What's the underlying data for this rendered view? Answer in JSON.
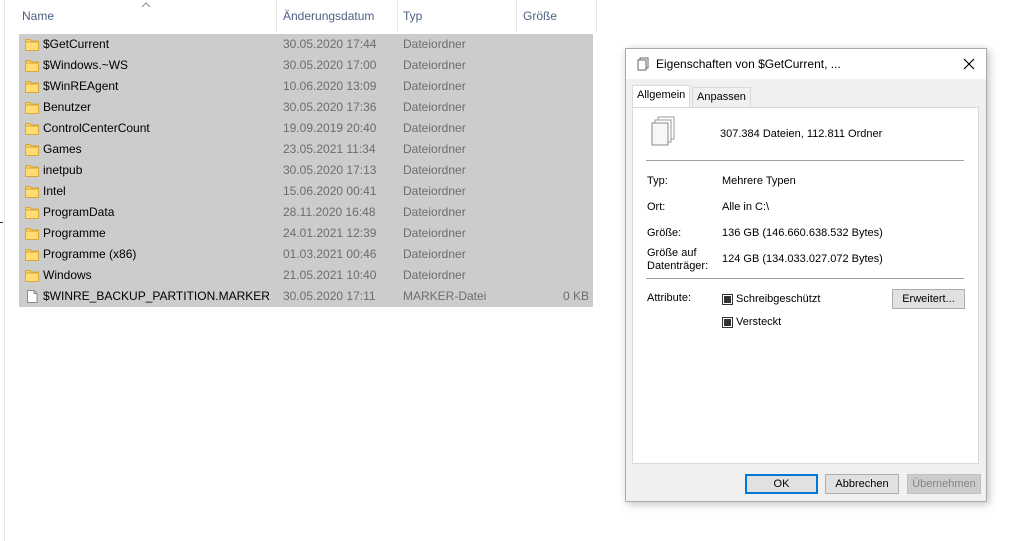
{
  "explorer": {
    "columns": {
      "name": "Name",
      "date": "Änderungsdatum",
      "type": "Typ",
      "size": "Größe"
    },
    "rows": [
      {
        "name": "$GetCurrent",
        "date": "30.05.2020 17:44",
        "type": "Dateiordner",
        "size": "",
        "icon": "folder-icon"
      },
      {
        "name": "$Windows.~WS",
        "date": "30.05.2020 17:00",
        "type": "Dateiordner",
        "size": "",
        "icon": "folder-icon"
      },
      {
        "name": "$WinREAgent",
        "date": "10.06.2020 13:09",
        "type": "Dateiordner",
        "size": "",
        "icon": "folder-icon"
      },
      {
        "name": "Benutzer",
        "date": "30.05.2020 17:36",
        "type": "Dateiordner",
        "size": "",
        "icon": "folder-icon"
      },
      {
        "name": "ControlCenterCount",
        "date": "19.09.2019 20:40",
        "type": "Dateiordner",
        "size": "",
        "icon": "folder-icon"
      },
      {
        "name": "Games",
        "date": "23.05.2021 11:34",
        "type": "Dateiordner",
        "size": "",
        "icon": "folder-icon"
      },
      {
        "name": "inetpub",
        "date": "30.05.2020 17:13",
        "type": "Dateiordner",
        "size": "",
        "icon": "folder-icon"
      },
      {
        "name": "Intel",
        "date": "15.06.2020 00:41",
        "type": "Dateiordner",
        "size": "",
        "icon": "folder-icon"
      },
      {
        "name": "ProgramData",
        "date": "28.11.2020 16:48",
        "type": "Dateiordner",
        "size": "",
        "icon": "folder-icon"
      },
      {
        "name": "Programme",
        "date": "24.01.2021 12:39",
        "type": "Dateiordner",
        "size": "",
        "icon": "folder-icon"
      },
      {
        "name": "Programme (x86)",
        "date": "01.03.2021 00:46",
        "type": "Dateiordner",
        "size": "",
        "icon": "folder-icon"
      },
      {
        "name": "Windows",
        "date": "21.05.2021 10:40",
        "type": "Dateiordner",
        "size": "",
        "icon": "folder-icon"
      },
      {
        "name": "$WINRE_BACKUP_PARTITION.MARKER",
        "date": "30.05.2020 17:11",
        "type": "MARKER-Datei",
        "size": "0 KB",
        "icon": "file-icon"
      }
    ]
  },
  "dialog": {
    "title": "Eigenschaften von $GetCurrent, ...",
    "tabs": [
      "Allgemein",
      "Anpassen"
    ],
    "summary": "307.384 Dateien, 112.811 Ordner",
    "fields": {
      "type_label": "Typ:",
      "type_value": "Mehrere Typen",
      "location_label": "Ort:",
      "location_value": "Alle in C:\\",
      "size_label": "Größe:",
      "size_value": "136 GB (146.660.638.532 Bytes)",
      "disk_label_1": "Größe auf",
      "disk_label_2": "Datenträger:",
      "disk_value": "124 GB (134.033.027.072 Bytes)",
      "attributes_label": "Attribute:"
    },
    "attributes": {
      "readonly": "Schreibgeschützt",
      "hidden": "Versteckt",
      "advanced_button": "Erweitert..."
    },
    "buttons": {
      "ok": "OK",
      "cancel": "Abbrechen",
      "apply": "Übernehmen"
    }
  },
  "colors": {
    "selection": "#cccccc",
    "header_text": "#4d6082",
    "accent": "#0078d7"
  }
}
